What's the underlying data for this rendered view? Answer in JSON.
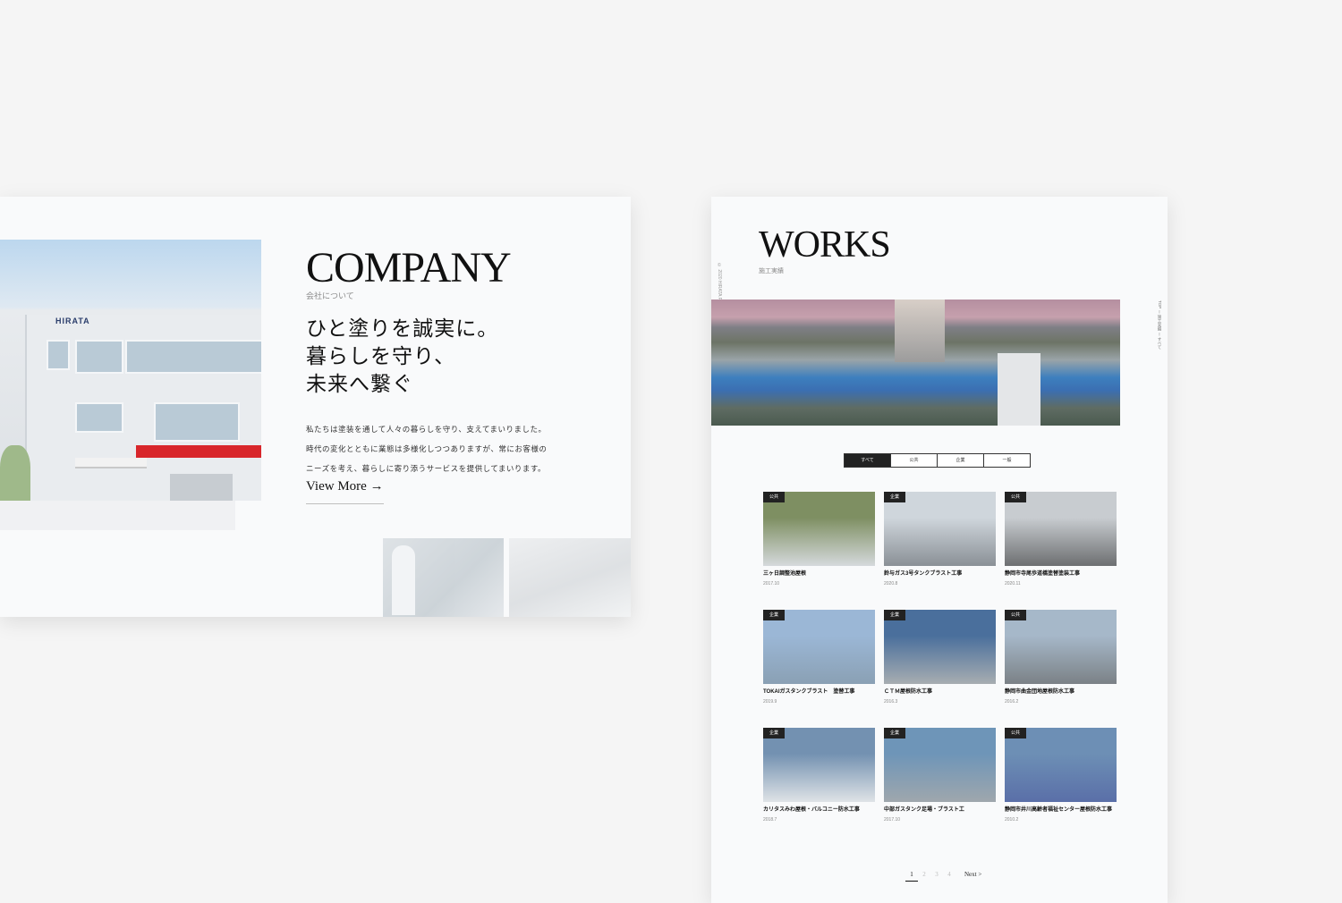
{
  "company": {
    "title": "COMPANY",
    "subtitle": "会社について",
    "heading_lines": [
      "ひと塗りを誠実に。",
      "暮らしを守り、",
      "未来へ繋ぐ"
    ],
    "body": "私たちは塗装を通して人々の暮らしを守り、支えてまいりました。時代の変化とともに業態は多様化しつつありますが、常にお客様のニーズを考え、暮らしに寄り添うサービスを提供してまいります。",
    "view_more": "View More →",
    "building_sign": "HIRATA"
  },
  "works": {
    "title": "WORKS",
    "subtitle": "施工実績",
    "copyright": "© 2020 HIRATA PAINT All Rights Reserved.",
    "breadcrumb": "TOP ー 施工実績 ー すべて",
    "filters": [
      "すべて",
      "公共",
      "企業",
      "一般"
    ],
    "active_filter": "すべて",
    "items": [
      {
        "badge": "公共",
        "title": "三ヶ日調整池屋根",
        "date": "2017.10",
        "color_top": "#7e8f62",
        "color_bottom": "#d5d9dc"
      },
      {
        "badge": "企業",
        "title": "鈴与ガス3号タンクブラスト工事",
        "date": "2020.8",
        "color_top": "#cfd6dc",
        "color_bottom": "#8a9096"
      },
      {
        "badge": "公共",
        "title": "静岡市寺尾歩道橋塗替塗装工事",
        "date": "2020.11",
        "color_top": "#c8ccd0",
        "color_bottom": "#6d6f71"
      },
      {
        "badge": "企業",
        "title": "TOKAIガスタンクブラスト　塗替工事",
        "date": "2019.9",
        "color_top": "#9bb7d6",
        "color_bottom": "#8aa0b4"
      },
      {
        "badge": "企業",
        "title": "ＣＴＭ屋根防水工事",
        "date": "2016.3",
        "color_top": "#4a6f9c",
        "color_bottom": "#a7adb1"
      },
      {
        "badge": "公共",
        "title": "静岡市曲金団地屋根防水工事",
        "date": "2016.2",
        "color_top": "#a6b8c9",
        "color_bottom": "#7b8186"
      },
      {
        "badge": "企業",
        "title": "カリタスみわ屋根・バルコニー防水工事",
        "date": "2018.7",
        "color_top": "#7391b1",
        "color_bottom": "#dfe3e6"
      },
      {
        "badge": "企業",
        "title": "中部ガスタンク足場・ブラスト工",
        "date": "2017.10",
        "color_top": "#6e95b8",
        "color_bottom": "#9fa7ad"
      },
      {
        "badge": "公共",
        "title": "静岡市井川高齢者福祉センター屋根防水工事",
        "date": "2010.2",
        "color_top": "#6d8fb5",
        "color_bottom": "#5a6fa8"
      }
    ],
    "pagination": {
      "pages": [
        "1",
        "2",
        "3",
        "4"
      ],
      "current": "1",
      "next": "Next >"
    }
  }
}
